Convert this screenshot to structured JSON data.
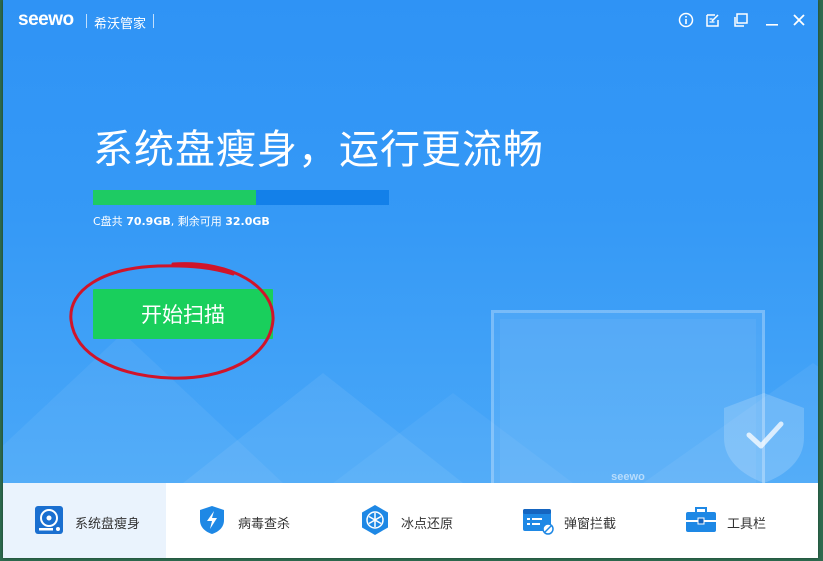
{
  "app": {
    "brand": "seewo",
    "title": "希沃管家"
  },
  "titlebar": {
    "icons": [
      "info-icon",
      "feedback-icon",
      "pin-icon",
      "minimize-icon",
      "close-icon"
    ]
  },
  "hero": {
    "headline": "系统盘瘦身，运行更流畅",
    "disk": {
      "prefix": "C盘共 ",
      "total": "70.9GB",
      "mid": ", 剩余可用 ",
      "free": "32.0GB",
      "used_fraction": 0.55
    },
    "scan_button": "开始扫描",
    "monitor_brand": "seewo"
  },
  "tabs": [
    {
      "label": "系统盘瘦身",
      "icon": "disk-cleanup-icon",
      "active": true
    },
    {
      "label": "病毒查杀",
      "icon": "virus-shield-icon",
      "active": false
    },
    {
      "label": "冰点还原",
      "icon": "snowflake-restore-icon",
      "active": false
    },
    {
      "label": "弹窗拦截",
      "icon": "popup-block-icon",
      "active": false
    },
    {
      "label": "工具栏",
      "icon": "toolbox-icon",
      "active": false
    }
  ],
  "colors": {
    "hero_blue": "#3599f6",
    "progress_green": "#1ecb63",
    "progress_track": "#1380e9",
    "button_green": "#19cf5c",
    "annotation_red": "#d0142a"
  }
}
